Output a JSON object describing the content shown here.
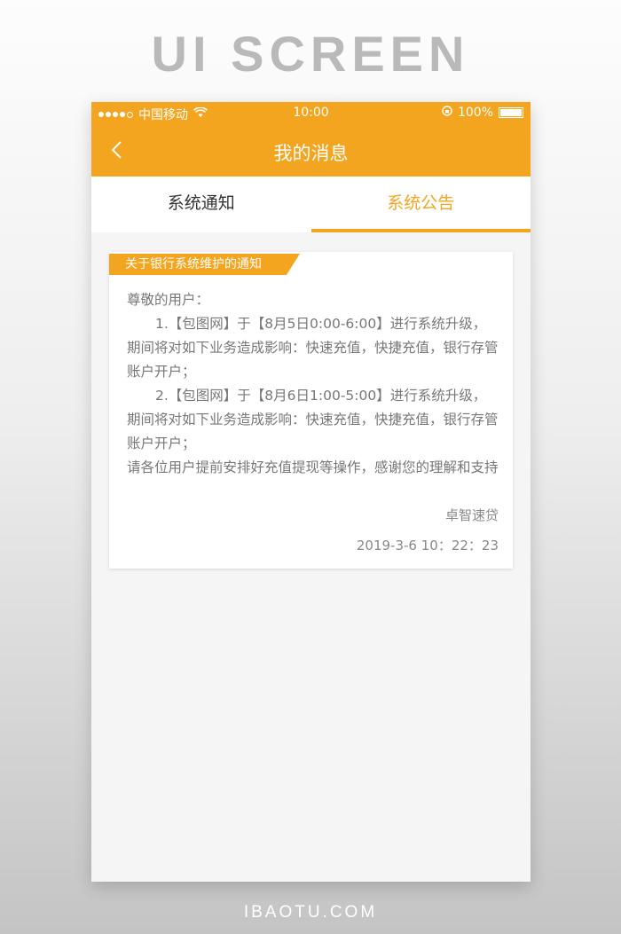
{
  "page_title": "UI SCREEN",
  "status": {
    "carrier": "中国移动",
    "time": "10:00",
    "battery": "100%"
  },
  "nav": {
    "title": "我的消息"
  },
  "tabs": [
    {
      "label": "系统通知",
      "active": false
    },
    {
      "label": "系统公告",
      "active": true
    }
  ],
  "notice": {
    "title": "关于银行系统维护的通知",
    "greeting": "尊敬的用户：",
    "item1": "1.【包图网】于【8月5日0:00-6:00】进行系统升级，期间将对如下业务造成影响：快速充值，快捷充值，银行存管账户开户；",
    "item2": "2.【包图网】于【8月6日1:00-5:00】进行系统升级，期间将对如下业务造成影响：快速充值，快捷充值，银行存管账户开户；",
    "closing": "请各位用户提前安排好充值提现等操作，感谢您的理解和支持",
    "signature": "卓智速贷",
    "datetime": "2019-3-6 10：22：23"
  },
  "footer": "IBAOTU.COM",
  "colors": {
    "accent": "#f3a51f"
  }
}
